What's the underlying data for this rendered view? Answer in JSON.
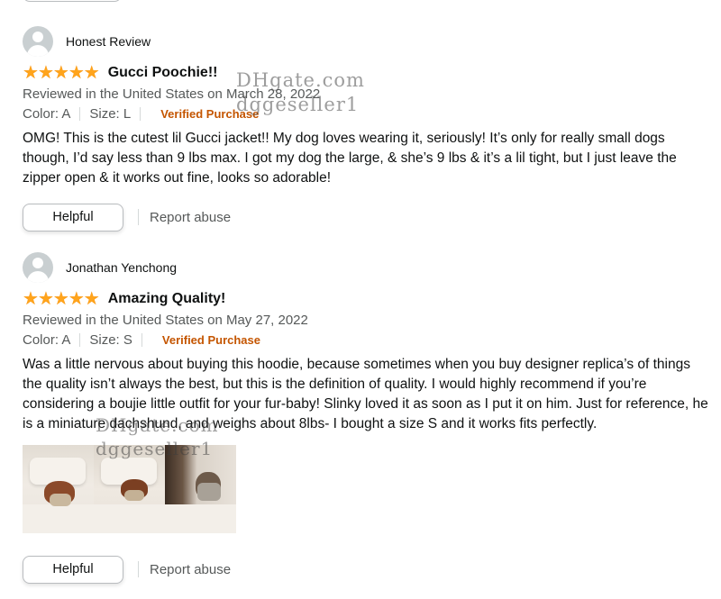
{
  "reviews": [
    {
      "reviewer": "Honest Review",
      "rating": 5,
      "title": "Gucci Poochie!!",
      "date_line": "Reviewed in the United States on March 28, 2022",
      "color": "Color: A",
      "size": "Size: L",
      "verified": "Verified Purchase",
      "body": "OMG! This is the cutest lil Gucci jacket!! My dog loves wearing it, seriously! It’s only for really small dogs though, I’d say less than 9 lbs max. I got my dog the large, & she’s 9 lbs & it’s a lil tight, but I just leave the zipper open & it works out fine, looks so adorable!",
      "helpful_label": "Helpful",
      "report_label": "Report abuse"
    },
    {
      "reviewer": "Jonathan Yenchong",
      "rating": 5,
      "title": "Amazing Quality!",
      "date_line": "Reviewed in the United States on May 27, 2022",
      "color": "Color: A",
      "size": "Size: S",
      "verified": "Verified Purchase",
      "body": "Was a little nervous about buying this hoodie, because sometimes when you buy designer replica’s of things the quality isn’t always the best, but this is the definition of quality. I would highly recommend if you’re considering a boujie little outfit for your fur-baby! Slinky loved it as soon as I put it on him. Just for reference, he is a miniature dachshund, and weighs about 8lbs- I bought a size S and it works fits perfectly.",
      "photo_count": 3,
      "helpful_label": "Helpful",
      "report_label": "Report abuse"
    }
  ],
  "watermarks": {
    "site": "DHgate.com",
    "seller": "dggeseller1"
  },
  "colors": {
    "star": "#ffa41c",
    "verified": "#c45500",
    "muted_text": "#565959"
  }
}
